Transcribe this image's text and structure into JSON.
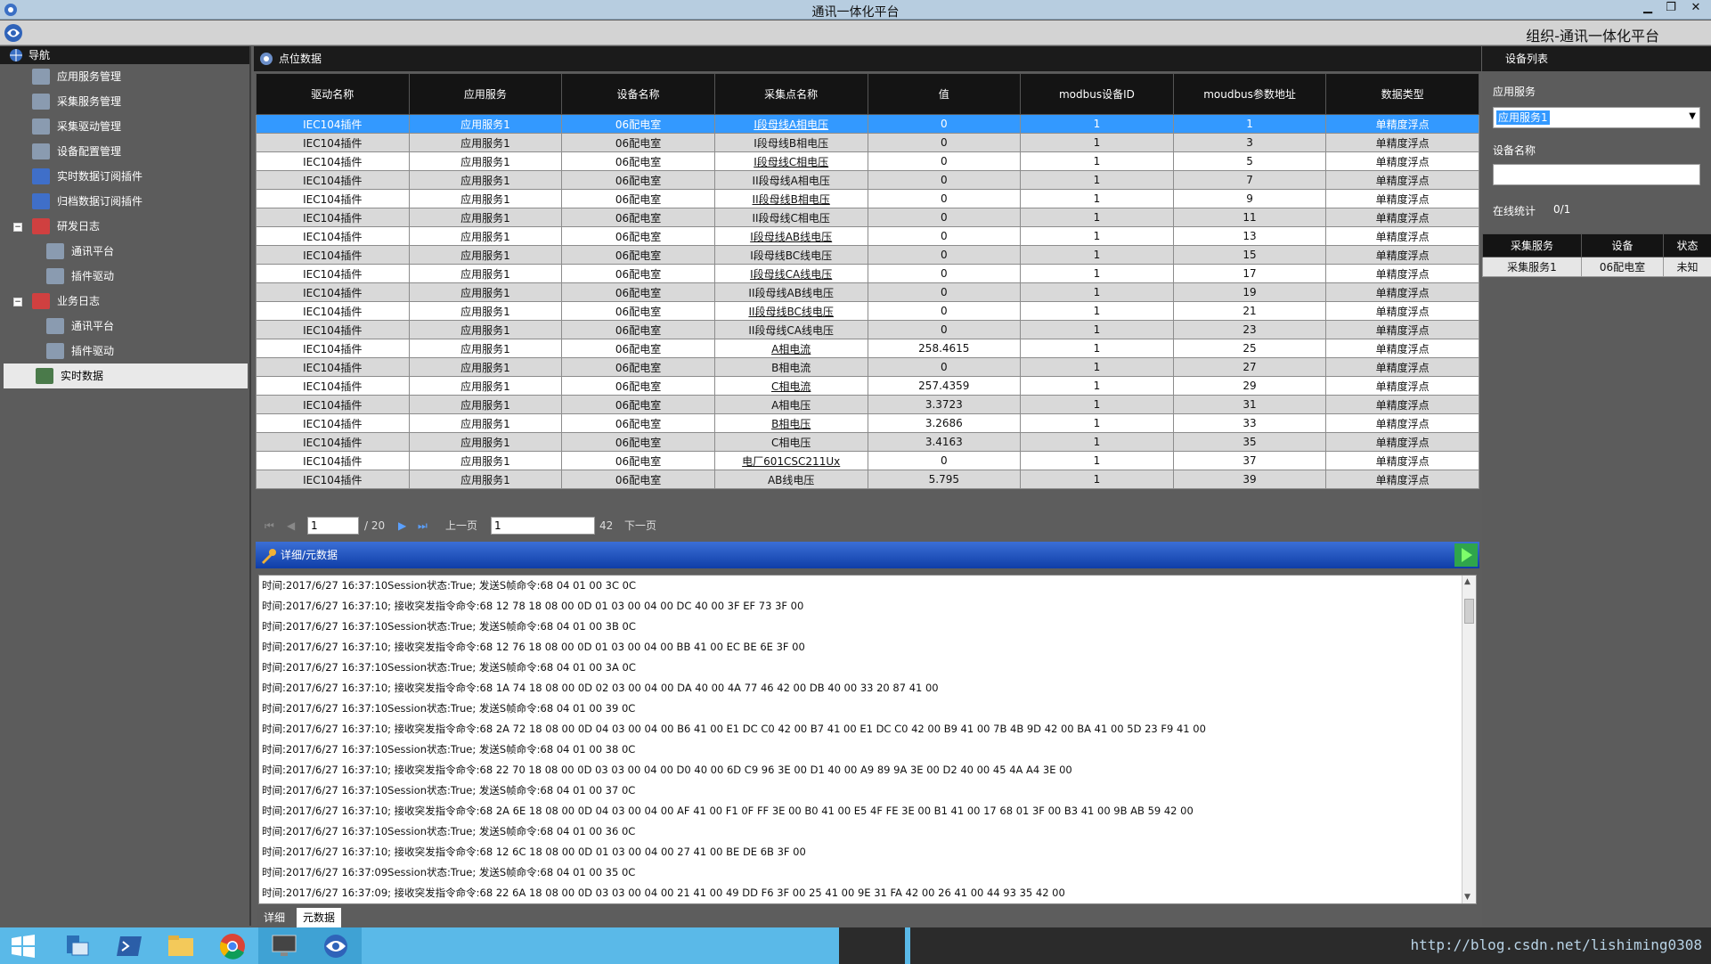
{
  "window": {
    "title": "通讯一体化平台",
    "org": "组织-通讯一体化平台"
  },
  "nav": {
    "header": "导航",
    "items": [
      {
        "label": "应用服务管理",
        "icon": "gear-icon",
        "level": 0
      },
      {
        "label": "采集服务管理",
        "icon": "gear-icon",
        "level": 0
      },
      {
        "label": "采集驱动管理",
        "icon": "gear-icon",
        "level": 0
      },
      {
        "label": "设备配置管理",
        "icon": "gear-icon",
        "level": 0
      },
      {
        "label": "实时数据订阅插件",
        "icon": "plugin-icon",
        "level": 0
      },
      {
        "label": "归档数据订阅插件",
        "icon": "plugin-icon",
        "level": 0
      },
      {
        "label": "研发日志",
        "icon": "log-icon",
        "level": 0,
        "toggle": "−"
      },
      {
        "label": "通讯平台",
        "icon": "gear-icon",
        "level": 1
      },
      {
        "label": "插件驱动",
        "icon": "gear-icon",
        "level": 1
      },
      {
        "label": "业务日志",
        "icon": "log-icon",
        "level": 0,
        "toggle": "−"
      },
      {
        "label": "通讯平台",
        "icon": "gear-icon",
        "level": 1
      },
      {
        "label": "插件驱动",
        "icon": "gear-icon",
        "level": 1
      },
      {
        "label": "实时数据",
        "icon": "monitor-icon",
        "level": 0,
        "selected": true
      }
    ]
  },
  "points": {
    "title": "点位数据",
    "columns": [
      "驱动名称",
      "应用服务",
      "设备名称",
      "采集点名称",
      "值",
      "modbus设备ID",
      "moudbus参数地址",
      "数据类型"
    ],
    "rows": [
      [
        "IEC104插件",
        "应用服务1",
        "06配电室",
        "I段母线A相电压",
        "0",
        "1",
        "1",
        "单精度浮点"
      ],
      [
        "IEC104插件",
        "应用服务1",
        "06配电室",
        "I段母线B相电压",
        "0",
        "1",
        "3",
        "单精度浮点"
      ],
      [
        "IEC104插件",
        "应用服务1",
        "06配电室",
        "I段母线C相电压",
        "0",
        "1",
        "5",
        "单精度浮点"
      ],
      [
        "IEC104插件",
        "应用服务1",
        "06配电室",
        "II段母线A相电压",
        "0",
        "1",
        "7",
        "单精度浮点"
      ],
      [
        "IEC104插件",
        "应用服务1",
        "06配电室",
        "II段母线B相电压",
        "0",
        "1",
        "9",
        "单精度浮点"
      ],
      [
        "IEC104插件",
        "应用服务1",
        "06配电室",
        "II段母线C相电压",
        "0",
        "1",
        "11",
        "单精度浮点"
      ],
      [
        "IEC104插件",
        "应用服务1",
        "06配电室",
        "I段母线AB线电压",
        "0",
        "1",
        "13",
        "单精度浮点"
      ],
      [
        "IEC104插件",
        "应用服务1",
        "06配电室",
        "I段母线BC线电压",
        "0",
        "1",
        "15",
        "单精度浮点"
      ],
      [
        "IEC104插件",
        "应用服务1",
        "06配电室",
        "I段母线CA线电压",
        "0",
        "1",
        "17",
        "单精度浮点"
      ],
      [
        "IEC104插件",
        "应用服务1",
        "06配电室",
        "II段母线AB线电压",
        "0",
        "1",
        "19",
        "单精度浮点"
      ],
      [
        "IEC104插件",
        "应用服务1",
        "06配电室",
        "II段母线BC线电压",
        "0",
        "1",
        "21",
        "单精度浮点"
      ],
      [
        "IEC104插件",
        "应用服务1",
        "06配电室",
        "II段母线CA线电压",
        "0",
        "1",
        "23",
        "单精度浮点"
      ],
      [
        "IEC104插件",
        "应用服务1",
        "06配电室",
        "A相电流",
        "258.4615",
        "1",
        "25",
        "单精度浮点"
      ],
      [
        "IEC104插件",
        "应用服务1",
        "06配电室",
        "B相电流",
        "0",
        "1",
        "27",
        "单精度浮点"
      ],
      [
        "IEC104插件",
        "应用服务1",
        "06配电室",
        "C相电流",
        "257.4359",
        "1",
        "29",
        "单精度浮点"
      ],
      [
        "IEC104插件",
        "应用服务1",
        "06配电室",
        "A相电压",
        "3.3723",
        "1",
        "31",
        "单精度浮点"
      ],
      [
        "IEC104插件",
        "应用服务1",
        "06配电室",
        "B相电压",
        "3.2686",
        "1",
        "33",
        "单精度浮点"
      ],
      [
        "IEC104插件",
        "应用服务1",
        "06配电室",
        "C相电压",
        "3.4163",
        "1",
        "35",
        "单精度浮点"
      ],
      [
        "IEC104插件",
        "应用服务1",
        "06配电室",
        "电厂601CSC211Ux",
        "0",
        "1",
        "37",
        "单精度浮点"
      ],
      [
        "IEC104插件",
        "应用服务1",
        "06配电室",
        "AB线电压",
        "5.795",
        "1",
        "39",
        "单精度浮点"
      ]
    ],
    "selected_row": 0
  },
  "pager": {
    "page": "1",
    "total_pages": "/ 20",
    "prev": "上一页",
    "next": "下一页",
    "goto_value": "1",
    "total": "42"
  },
  "detail": {
    "title": "详细/元数据",
    "lines": [
      "时间:2017/6/27 16:37:10Session状态:True; 发送S帧命令:68 04 01 00 3C 0C",
      "时间:2017/6/27 16:37:10; 接收突发指令命令:68 12 78 18 08 00 0D 01 03 00 04 00 DC 40 00 3F EF 73 3F 00",
      "时间:2017/6/27 16:37:10Session状态:True; 发送S帧命令:68 04 01 00 3B 0C",
      "时间:2017/6/27 16:37:10; 接收突发指令命令:68 12 76 18 08 00 0D 01 03 00 04 00 BB 41 00 EC BE 6E 3F 00",
      "时间:2017/6/27 16:37:10Session状态:True; 发送S帧命令:68 04 01 00 3A 0C",
      "时间:2017/6/27 16:37:10; 接收突发指令命令:68 1A 74 18 08 00 0D 02 03 00 04 00 DA 40 00 4A 77 46 42 00 DB 40 00 33 20 87 41 00",
      "时间:2017/6/27 16:37:10Session状态:True; 发送S帧命令:68 04 01 00 39 0C",
      "时间:2017/6/27 16:37:10; 接收突发指令命令:68 2A 72 18 08 00 0D 04 03 00 04 00 B6 41 00 E1 DC C0 42 00 B7 41 00 E1 DC C0 42 00 B9 41 00 7B 4B 9D 42 00 BA 41 00 5D 23 F9 41 00",
      "时间:2017/6/27 16:37:10Session状态:True; 发送S帧命令:68 04 01 00 38 0C",
      "时间:2017/6/27 16:37:10; 接收突发指令命令:68 22 70 18 08 00 0D 03 03 00 04 00 D0 40 00 6D C9 96 3E 00 D1 40 00 A9 89 9A 3E 00 D2 40 00 45 4A A4 3E 00",
      "时间:2017/6/27 16:37:10Session状态:True; 发送S帧命令:68 04 01 00 37 0C",
      "时间:2017/6/27 16:37:10; 接收突发指令命令:68 2A 6E 18 08 00 0D 04 03 00 04 00 AF 41 00 F1 0F FF 3E 00 B0 41 00 E5 4F FE 3E 00 B1 41 00 17 68 01 3F 00 B3 41 00 9B AB 59 42 00",
      "时间:2017/6/27 16:37:10Session状态:True; 发送S帧命令:68 04 01 00 36 0C",
      "时间:2017/6/27 16:37:10; 接收突发指令命令:68 12 6C 18 08 00 0D 01 03 00 04 00 27 41 00 BE DE 6B 3F 00",
      "时间:2017/6/27 16:37:09Session状态:True; 发送S帧命令:68 04 01 00 35 0C",
      "时间:2017/6/27 16:37:09; 接收突发指令命令:68 22 6A 18 08 00 0D 03 03 00 04 00 21 41 00 49 DD F6 3F 00 25 41 00 9E 31 FA 42 00 26 41 00 44 93 35 42 00"
    ],
    "tabs": [
      "详细",
      "元数据"
    ]
  },
  "device_list": {
    "title": "设备列表",
    "app_service_label": "应用服务",
    "app_service_value": "应用服务1",
    "device_name_label": "设备名称",
    "device_name_value": "",
    "online_label": "在线统计",
    "online_value": "0/1",
    "columns": [
      "采集服务",
      "设备",
      "状态"
    ],
    "rows": [
      [
        "采集服务1",
        "06配电室",
        "未知"
      ]
    ]
  },
  "taskbar": {
    "watermark": "http://blog.csdn.net/lishiming0308"
  }
}
